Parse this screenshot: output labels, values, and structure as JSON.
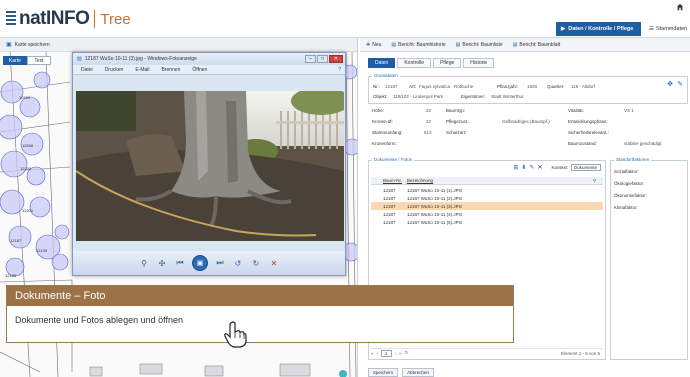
{
  "app": {
    "logo_text": "natINFO",
    "logo_sub": "Tree"
  },
  "header": {
    "active_tab": "Daten / Kontrolle / Pflege",
    "tab2": "Stammdaten"
  },
  "map": {
    "toolbar_label": "Karte speichern",
    "tabs": [
      "Karte",
      "Text"
    ],
    "tree_labels": [
      "12695",
      "12698",
      "12205",
      "12201",
      "12187",
      "12149",
      "12181",
      "12185"
    ]
  },
  "viewer": {
    "title": "12187 WuSo 10-11 (3).jpg - Windows-Fotoanzeige",
    "menu": [
      "Datei",
      "Drucken",
      "E-Mail",
      "Brennen",
      "Öffnen"
    ]
  },
  "right": {
    "toolbar": [
      "Neu",
      "Bericht: Baumhistorie",
      "Bericht: Baumliste",
      "Bericht: Baumblatt"
    ],
    "tabs": [
      "Daten",
      "Kontrolle",
      "Pflege",
      "Historie"
    ],
    "grunddaten_title": "Grunddaten",
    "grunddaten": {
      "nr_label": "Nr.:",
      "nr": "12187",
      "art_label": "Art:",
      "art": "Fagus sylvatica - Rotbuche",
      "pflanzjahr_label": "Pflanzjahr:",
      "pflanzjahr": "1928",
      "quartier_label": "Quartier:",
      "quartier": "118 - Altdorf",
      "objekt_label": "Objekt:",
      "objekt": "118/102 - Lindenpol Park",
      "eigentuemer_label": "Eigentümer:",
      "eigentuemer": "Stadt Winterthur"
    },
    "details": {
      "hoehe_label": "Höhe:",
      "hoehe": "22",
      "krone_label": "Kronen-Ø:",
      "krone": "22",
      "stamm_label": "Stammumfang:",
      "stamm": "513",
      "kronenform_label": "Kronenform:",
      "baumtyp_label": "Baumtyp:",
      "pflegezust_label": "Pflegezust.:",
      "pflegezust": "Gelbnadriges (Baumpf.)",
      "schutzart_label": "Schutzart:",
      "vitalitaet_label": "Vitalität:",
      "vitalitaet": "VS 1",
      "entwicklung_label": "Entwicklungsphase:",
      "sicherheit_label": "Sicherheitsrelevant.:",
      "baumzustand_label": "Baumzustand:",
      "baumzustand": "stabiler geschädigt"
    },
    "documents_title": "Dokumente / Fotos",
    "documents_sort_label": "Kontext:",
    "documents_sort_value": "Dokumente",
    "documents_headers": [
      "Baum-Nr.",
      "Bezeichnung"
    ],
    "documents": [
      {
        "nr": "12187",
        "name": "12187 WuSo 10-11 (1).JPG",
        "selected": false
      },
      {
        "nr": "12187",
        "name": "12187 WuSo 10-11 (2).JPG",
        "selected": false
      },
      {
        "nr": "12187",
        "name": "12187 WuSo 10-11 (3).JPG",
        "selected": true
      },
      {
        "nr": "12187",
        "name": "12187 WuSo 10-11 (4).JPG",
        "selected": false
      },
      {
        "nr": "12187",
        "name": "12187 WuSo 10-11 (5).JPG",
        "selected": false
      }
    ],
    "pager_text": "1",
    "pager_count": "Element 1 - 5 von 5",
    "standort_title": "Standortfaktoren",
    "standort": [
      "Sozialfaktor:",
      "Ökologiefaktor:",
      "Ökonomiefaktor:",
      "Klimafaktor:"
    ],
    "buttons": {
      "save": "Speichern",
      "cancel": "Abbrechen"
    }
  },
  "caption": {
    "title": "Dokumente – Foto",
    "text": "Dokumente und Fotos ablegen und öffnen"
  },
  "colors": {
    "accent": "#1e5fa4",
    "caption": "#9c7346",
    "selected_row": "#fbd8b3"
  }
}
